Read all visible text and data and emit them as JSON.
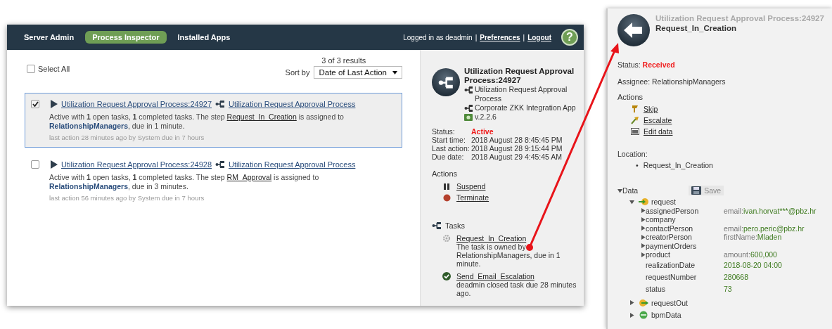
{
  "nav": {
    "tabs": [
      {
        "label": "Server Admin",
        "selected": false
      },
      {
        "label": "Process Inspector",
        "selected": true
      },
      {
        "label": "Installed Apps",
        "selected": false
      }
    ],
    "account": [
      {
        "kind": "text",
        "text": "Logged in as deadmin"
      },
      {
        "kind": "separator",
        "text": "|"
      },
      {
        "kind": "link",
        "text": "Preferences"
      },
      {
        "kind": "separator",
        "text": "|"
      },
      {
        "kind": "link",
        "text": "Logout"
      }
    ],
    "help": "?"
  },
  "list": {
    "select_all": {
      "label": "Select All",
      "checked": false
    },
    "results": "3 of 3 results",
    "sort_label": "Sort by",
    "sort_value": "Date of Last Action",
    "processes": [
      {
        "checked": true,
        "selected": true,
        "title": "Utilization Request Approval Process:24927",
        "model": "Utilization Request Approval Process",
        "summary": [
          {
            "kind": "text",
            "text": "Active with **1** open tasks, **1** completed tasks. The step "
          },
          {
            "kind": "link",
            "text": "Request_In_Creation"
          },
          {
            "kind": "text",
            "text": " is assigned to "
          },
          {
            "kind": "assignee",
            "text": "RelationshipManagers"
          },
          {
            "kind": "text",
            "text": ", due in 1 minute."
          }
        ],
        "meta": "last action 28 minutes ago by System due in 7 hours"
      },
      {
        "checked": false,
        "selected": false,
        "title": "Utilization Request Approval Process:24928",
        "model": "Utilization Request Approval Process",
        "summary": [
          {
            "kind": "text",
            "text": "Active with **1** open tasks, **1** completed tasks. The step "
          },
          {
            "kind": "link",
            "text": "RM_Approval"
          },
          {
            "kind": "text",
            "text": " is assigned to "
          },
          {
            "kind": "assignee",
            "text": "RelationshipManagers"
          },
          {
            "kind": "text",
            "text": ", due in 3 minutes."
          }
        ],
        "meta": "last action 56 minutes ago by System due in 7 hours"
      }
    ]
  },
  "details": {
    "title": "Utilization Request Approval Process:24927",
    "model": "Utilization Request Approval Process",
    "app": "Corporate ZKK Integration App",
    "version": "v.2.2.6",
    "fields": [
      {
        "label": "Status:",
        "value": "Active",
        "kind": "status"
      },
      {
        "label": "Start time:",
        "value": "2018 August 28 8:45:45 PM",
        "kind": "plain"
      },
      {
        "label": "Last action:",
        "value": "2018 August 28 9:15:44 PM",
        "kind": "plain"
      },
      {
        "label": "Due date:",
        "value": "2018 August 29 4:45:45 AM",
        "kind": "plain"
      }
    ],
    "actions_heading": "Actions",
    "actions": [
      {
        "label": "Suspend",
        "kind": "pause"
      },
      {
        "label": "Terminate",
        "kind": "stop"
      }
    ],
    "tasks_heading": "Tasks",
    "tasks": [
      {
        "name": "Request_In_Creation",
        "kind": "open",
        "description": "The task is owned by RelationshipManagers, due in 1 minute."
      },
      {
        "name": "Send_Email_Escalation",
        "kind": "done",
        "description": "deadmin closed task due 28 minutes ago."
      }
    ]
  },
  "task_popup": {
    "process": "Utilization Request Approval Process:24927",
    "task": "Request_In_Creation",
    "status_label": "Status:",
    "status_value": "Received",
    "assignee": "Assignee: RelationshipManagers",
    "actions_heading": "Actions",
    "actions": [
      {
        "label": "Skip",
        "kind": "skip"
      },
      {
        "label": "Escalate",
        "kind": "escalate"
      },
      {
        "label": "Edit data",
        "kind": "edit"
      }
    ],
    "location_label": "Location:",
    "location": [
      {
        "bullet": "•",
        "text": "Request_In_Creation"
      }
    ],
    "data": {
      "label": "Data",
      "expanded": true,
      "save": {
        "label": "Save",
        "disabled": true
      },
      "children": [
        {
          "name": "request",
          "kind": "input",
          "expanded": true,
          "children": [
            {
              "name": "assignedPerson",
              "kind": "object",
              "expanded": false,
              "preview_label": "email:",
              "preview_value": "ivan.horvat***@pbz.hr"
            },
            {
              "name": "company",
              "kind": "object",
              "expanded": false
            },
            {
              "name": "contactPerson",
              "kind": "object",
              "expanded": false,
              "preview_label": "email:",
              "preview_value": "pero.peric@pbz.hr"
            },
            {
              "name": "creatorPerson",
              "kind": "object",
              "expanded": false,
              "preview_label": "firstName:",
              "preview_value": "Mladen"
            },
            {
              "name": "paymentOrders",
              "kind": "object",
              "expanded": false
            },
            {
              "name": "product",
              "kind": "object",
              "expanded": false,
              "preview_label": "amount:",
              "preview_value": "600,000"
            },
            {
              "name": "realizationDate",
              "kind": "value",
              "value": "2018-08-20 04:00"
            },
            {
              "name": "requestNumber",
              "kind": "value",
              "value": "280668"
            },
            {
              "name": "status",
              "kind": "value",
              "value": "73"
            }
          ]
        },
        {
          "name": "requestOut",
          "kind": "output",
          "expanded": false
        },
        {
          "name": "bpmData",
          "kind": "private",
          "expanded": false
        }
      ]
    }
  }
}
